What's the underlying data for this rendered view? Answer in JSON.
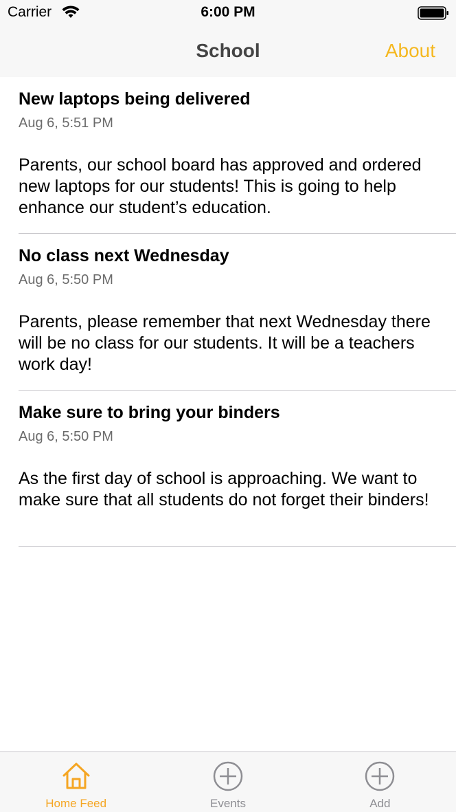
{
  "status_bar": {
    "carrier": "Carrier",
    "time": "6:00 PM",
    "wifi_icon": "wifi-icon",
    "battery_icon": "battery-icon"
  },
  "nav": {
    "title": "School",
    "about_label": "About",
    "accent_color": "#f5b820"
  },
  "feed": {
    "posts": [
      {
        "title": "New laptops being delivered",
        "date": "Aug 6, 5:51 PM",
        "body": "Parents, our school board has approved and ordered new laptops for our students! This is going to help enhance our student’s education."
      },
      {
        "title": "No class next Wednesday",
        "date": "Aug 6, 5:50 PM",
        "body": "Parents, please remember that next Wednesday there will be no class for our students. It will be a teachers work day!"
      },
      {
        "title": "Make sure to bring your binders",
        "date": "Aug 6, 5:50 PM",
        "body": "As the first day of school is approaching. We want to make sure that all students do not forget their binders!"
      }
    ]
  },
  "tab_bar": {
    "tabs": [
      {
        "label": "Home Feed",
        "icon": "home-icon",
        "active": true
      },
      {
        "label": "Events",
        "icon": "plus-circle-icon",
        "active": false
      },
      {
        "label": "Add",
        "icon": "plus-circle-icon",
        "active": false
      }
    ],
    "active_color": "#f5a623",
    "inactive_color": "#8e8e93"
  }
}
